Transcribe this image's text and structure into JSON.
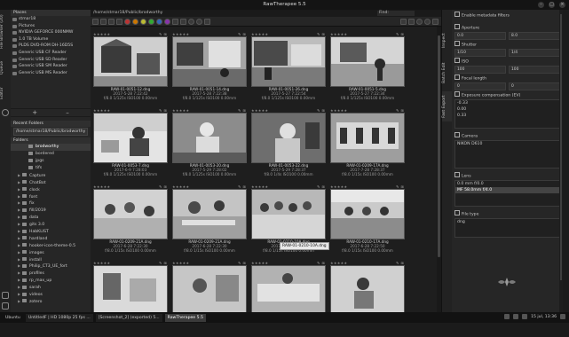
{
  "window": {
    "title": "RawTherapee 5.5",
    "controls": [
      "–",
      "□",
      "×"
    ]
  },
  "left_tabs": [
    "File Browser (20)",
    "Queue",
    "Editor"
  ],
  "places": {
    "header": "Places",
    "items": [
      "stmar18",
      "Pictures",
      "NVIDIA GEFORCE 000NMW",
      "1.0 TB Volume",
      "PLDS DVD-ROM DH-16D5S",
      "Generic USB CF Reader",
      "Generic USB SD Reader",
      "Generic USB SM Reader",
      "Generic USB MS Reader"
    ],
    "add_label": "+",
    "remove_label": "–"
  },
  "recent": {
    "header": "Recent Folders",
    "path": "/home/stmar18/Public/brodworthy"
  },
  "folders": {
    "header": "Folders",
    "items": [
      {
        "label": "brodworthy",
        "selected": true
      },
      {
        "label": "bordered"
      },
      {
        "label": "jpgs"
      },
      {
        "label": "tifs"
      },
      {
        "label": "Capture"
      },
      {
        "label": "ChatBot"
      },
      {
        "label": "clock"
      },
      {
        "label": "font"
      },
      {
        "label": "fix"
      },
      {
        "label": "fill/2019"
      },
      {
        "label": "data"
      },
      {
        "label": "gits 3.0"
      },
      {
        "label": "HabKLIST"
      },
      {
        "label": "hardland"
      },
      {
        "label": "hooker-icon-theme-0.5"
      },
      {
        "label": "images"
      },
      {
        "label": "install"
      },
      {
        "label": "Philip_CT3_UE_fort"
      },
      {
        "label": "profiles"
      },
      {
        "label": "rp_max_up"
      },
      {
        "label": "sarah"
      },
      {
        "label": "videos"
      },
      {
        "label": "zotero"
      }
    ]
  },
  "main": {
    "path": "/home/stmar18/Public/brodworthy",
    "search_placeholder": "Find:"
  },
  "thumbnails": [
    {
      "name": "RAW-01-0051-12.dng",
      "date": "2017-5-28 7:22:42",
      "exif": "f/8.0 1/125s ISO100 0.00mm"
    },
    {
      "name": "RAW-01-0051-14.dng",
      "date": "2017-5-28 7:22:38",
      "exif": "f/8.0 1/125s ISO100 0.00mm"
    },
    {
      "name": "RAW-01-0051-26.dng",
      "date": "2017-5-27 7:22:54",
      "exif": "f/8.0 1/125s ISO100 0.00mm"
    },
    {
      "name": "RAW-01-0051-5.dng",
      "date": "2017-5-27 7:22:34",
      "exif": "f/8.0 1/125s ISO100 0.00mm"
    },
    {
      "name": "RAW-01-0053-7.dng",
      "date": "2017-6-9 7:28:03",
      "exif": "f/8.0 1/125s ISO100 0.00mm"
    },
    {
      "name": "RAW-01-0053-20.dng",
      "date": "2017-5-29 7:28:02",
      "exif": "f/8.0 1/125s ISO100 0.00mm"
    },
    {
      "name": "RAW-01-0053-22.dng",
      "date": "2017-5-29 7:28:37",
      "exif": "f/8.0 1/4s ISO100 0.00mm"
    },
    {
      "name": "RAW-01-0209-17A.dng",
      "date": "2017-7-28 7:28:37",
      "exif": "f/8.0 1/15s ISO100 0.00mm"
    },
    {
      "name": "RAW-01-0209-21A.dng",
      "date": "2017-6-28 7:22:30",
      "exif": "f/8.0 1/15s ISO100 0.00mm"
    },
    {
      "name": "RAW-01-0209-21A.dng",
      "date": "2017-6-28 7:22:30",
      "exif": "f/8.0 1/15s ISO100 0.00mm"
    },
    {
      "name": "RAW-01-0210-10A.dng",
      "date": "2017-6-28 7:21:09",
      "exif": "f/8.0 1/15s ISO100 0.00mm"
    },
    {
      "name": "RAW-01-0210-17A.dng",
      "date": "2017-6-28 7:22:50",
      "exif": "f/8.0 1/15s ISO100 0.00mm"
    },
    {
      "name": "",
      "date": "",
      "exif": ""
    },
    {
      "name": "",
      "date": "",
      "exif": ""
    },
    {
      "name": "",
      "date": "",
      "exif": ""
    },
    {
      "name": "",
      "date": "",
      "exif": ""
    }
  ],
  "tooltip": "RAW-01-0210-10A.dng",
  "right_tabs": [
    "Inspect",
    "Batch Edit",
    "Fast Export"
  ],
  "filters": {
    "enable_label": "Enable metadata filters",
    "aperture": {
      "label": "Aperture",
      "from": "0.0",
      "to": "8.0"
    },
    "shutter": {
      "label": "Shutter",
      "from": "1/10",
      "to": "1/4"
    },
    "iso": {
      "label": "ISO",
      "from": "100",
      "to": "100"
    },
    "focal": {
      "label": "Focal length",
      "from": "0",
      "to": "0"
    },
    "exposure": {
      "label": "Exposure compensation (EV)",
      "values": [
        "-0.33",
        "0.00",
        "0.33"
      ]
    },
    "camera": {
      "label": "Camera",
      "values": [
        "NIKON D610"
      ]
    },
    "lens": {
      "label": "Lens",
      "values": [
        "0.0 mm f/0.0",
        "MF 58.0mm f/4.0"
      ]
    },
    "filetype": {
      "label": "File type",
      "values": [
        "dng"
      ]
    }
  },
  "taskbar": {
    "items": [
      "UntitledF | HD 1080p 25 fps ...",
      "[Screenshot_2] (exported) 5...",
      "RawTherapee 5.5"
    ],
    "start_label": "Ubuntu",
    "clock": "15 jul, 13:36"
  }
}
